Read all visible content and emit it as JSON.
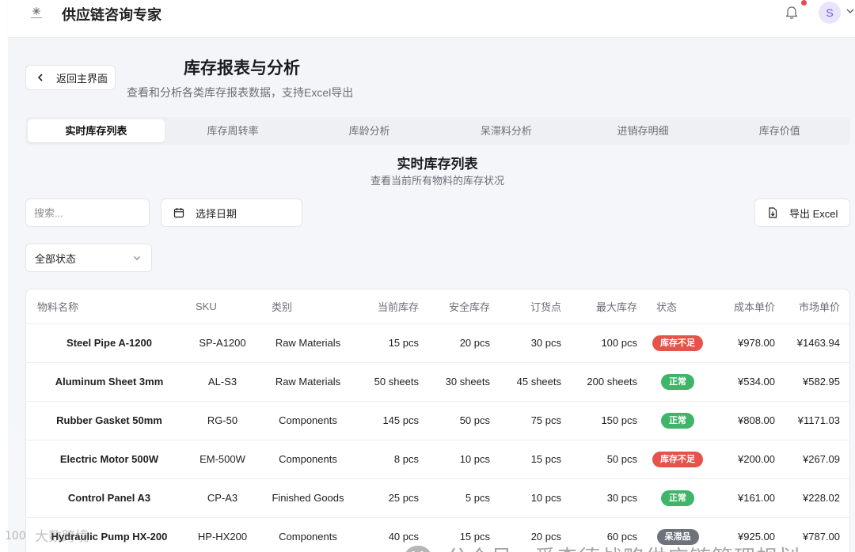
{
  "header": {
    "app_title": "供应链咨询专家",
    "avatar_letter": "S",
    "logo_icon": "brand-logo-icon",
    "notification_icon": "bell-icon"
  },
  "page": {
    "back_label": "返回主界面",
    "title": "库存报表与分析",
    "subtitle": "查看和分析各类库存报表数据，支持Excel导出"
  },
  "tabs": [
    {
      "label": "实时库存列表",
      "active": true
    },
    {
      "label": "库存周转率",
      "active": false
    },
    {
      "label": "库龄分析",
      "active": false
    },
    {
      "label": "呆滞料分析",
      "active": false
    },
    {
      "label": "进销存明细",
      "active": false
    },
    {
      "label": "库存价值",
      "active": false
    }
  ],
  "section": {
    "title": "实时库存列表",
    "subtitle": "查看当前所有物料的库存状况"
  },
  "filters": {
    "search_placeholder": "搜索...",
    "date_label": "选择日期",
    "export_label": "导出 Excel",
    "status_value": "全部状态"
  },
  "table": {
    "columns": [
      "物料名称",
      "SKU",
      "类别",
      "当前库存",
      "安全库存",
      "订货点",
      "最大库存",
      "状态",
      "成本单价",
      "市场单价"
    ],
    "rows": [
      {
        "name": "Steel Pipe A-1200",
        "sku": "SP-A1200",
        "category": "Raw Materials",
        "current": "15 pcs",
        "safety": "20 pcs",
        "reorder": "30 pcs",
        "max": "100 pcs",
        "status": "库存不足",
        "status_color": "#e5534b",
        "cost": "¥978.00",
        "market": "¥1463.94"
      },
      {
        "name": "Aluminum Sheet 3mm",
        "sku": "AL-S3",
        "category": "Raw Materials",
        "current": "50 sheets",
        "safety": "30 sheets",
        "reorder": "45 sheets",
        "max": "200 sheets",
        "status": "正常",
        "status_color": "#3fb56a",
        "cost": "¥534.00",
        "market": "¥582.95"
      },
      {
        "name": "Rubber Gasket 50mm",
        "sku": "RG-50",
        "category": "Components",
        "current": "145 pcs",
        "safety": "50 pcs",
        "reorder": "75 pcs",
        "max": "150 pcs",
        "status": "正常",
        "status_color": "#3fb56a",
        "cost": "¥808.00",
        "market": "¥1171.03"
      },
      {
        "name": "Electric Motor 500W",
        "sku": "EM-500W",
        "category": "Components",
        "current": "8 pcs",
        "safety": "10 pcs",
        "reorder": "15 pcs",
        "max": "50 pcs",
        "status": "库存不足",
        "status_color": "#e5534b",
        "cost": "¥200.00",
        "market": "¥267.09"
      },
      {
        "name": "Control Panel A3",
        "sku": "CP-A3",
        "category": "Finished Goods",
        "current": "25 pcs",
        "safety": "5 pcs",
        "reorder": "10 pcs",
        "max": "30 pcs",
        "status": "正常",
        "status_color": "#3fb56a",
        "cost": "¥161.00",
        "market": "¥228.02"
      },
      {
        "name": "Hydraulic Pump HX-200",
        "sku": "HP-HX200",
        "category": "Components",
        "current": "40 pcs",
        "safety": "15 pcs",
        "reorder": "20 pcs",
        "max": "60 pcs",
        "status": "呆滞品",
        "status_color": "#6e737b",
        "cost": "¥925.00",
        "market": "¥787.00"
      }
    ]
  },
  "watermark": {
    "text": "公众号 · 爱森德战略供应链管理规划",
    "icon": "wechat-icon",
    "corner_text": "大数跨境"
  }
}
